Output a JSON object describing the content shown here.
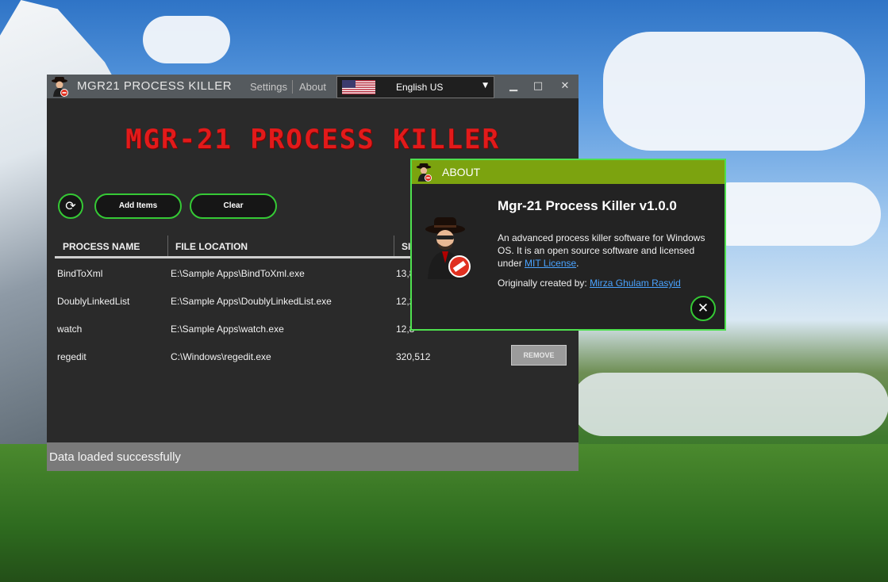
{
  "main_window": {
    "title": "MGR21 PROCESS KILLER",
    "menu": {
      "settings": "Settings",
      "about": "About"
    },
    "language": {
      "selected": "English US",
      "flag_icon": "us-flag-icon"
    },
    "controls": {
      "minimize": "▁",
      "maximize": "□",
      "close": "✕"
    },
    "logo_text": "MGR-21 PROCESS KILLER",
    "toolbar": {
      "refresh_icon": "refresh-icon",
      "add_label": "Add Items",
      "clear_label": "Clear"
    },
    "table": {
      "headers": [
        "PROCESS NAME",
        "FILE LOCATION",
        "SI"
      ],
      "rows": [
        {
          "name": "BindToXml",
          "location": "E:\\Sample Apps\\BindToXml.exe",
          "size": "13,8"
        },
        {
          "name": "DoublyLinkedList",
          "location": "E:\\Sample Apps\\DoublyLinkedList.exe",
          "size": "12,2"
        },
        {
          "name": "watch",
          "location": "E:\\Sample Apps\\watch.exe",
          "size": "12,8"
        },
        {
          "name": "regedit",
          "location": "C:\\Windows\\regedit.exe",
          "size": "320,512",
          "action": "REMOVE"
        }
      ]
    },
    "status": "Data loaded successfully"
  },
  "about_dialog": {
    "title": "ABOUT",
    "heading": "Mgr-21 Process Killer v1.0.0",
    "desc_before": "An advanced process killer software for Windows OS. It is an open source software and licensed under ",
    "license_link": "MIT License",
    "desc_after": ".",
    "credit_label": "Originally created by: ",
    "author": "Mirza Ghulam Rasyid",
    "close_icon": "close-icon"
  },
  "colors": {
    "accent_green": "#35c935",
    "about_header": "#7ca30f",
    "logo_red": "#e21a1a",
    "link_blue": "#4aa3ff"
  }
}
